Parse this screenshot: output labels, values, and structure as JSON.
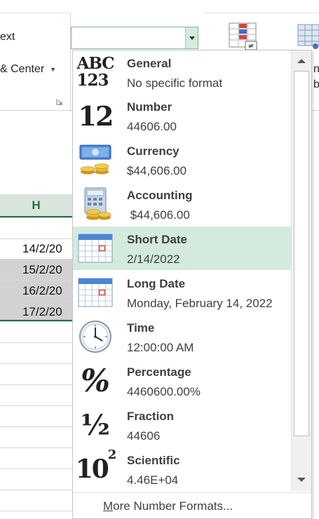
{
  "ribbon": {
    "wrap_text_fragment": "ext",
    "merge_center_fragment": "& Center",
    "number_format_value": "",
    "right_fragment_1": "na",
    "right_fragment_2": "ble"
  },
  "sheet": {
    "column_header": "H",
    "cells": [
      "14/2/20",
      "15/2/20",
      "16/2/20",
      "17/2/20"
    ]
  },
  "dropdown": {
    "items": [
      {
        "name": "General",
        "sample": "No specific format",
        "icon": "general-icon"
      },
      {
        "name": "Number",
        "sample": "44606.00",
        "icon": "number-icon"
      },
      {
        "name": "Currency",
        "sample": "$44,606.00",
        "icon": "currency-icon"
      },
      {
        "name": "Accounting",
        "sample": " $44,606.00",
        "icon": "accounting-icon"
      },
      {
        "name": "Short Date",
        "sample": "2/14/2022",
        "icon": "short-date-icon"
      },
      {
        "name": "Long Date",
        "sample": "Monday, February 14, 2022",
        "icon": "long-date-icon"
      },
      {
        "name": "Time",
        "sample": "12:00:00 AM",
        "icon": "clock-icon"
      },
      {
        "name": "Percentage",
        "sample": "4460600.00%",
        "icon": "percent-icon"
      },
      {
        "name": "Fraction",
        "sample": "44606",
        "icon": "fraction-icon"
      },
      {
        "name": "Scientific",
        "sample": "4.46E+04",
        "icon": "scientific-icon"
      }
    ],
    "more_formats_accel": "M",
    "more_formats_rest": "ore Number Formats..."
  },
  "glyphs": {
    "abc": "ABC",
    "n123": "123",
    "twelve": "12",
    "percent": "%",
    "half": "½",
    "ten": "10",
    "exp": "2"
  },
  "colors": {
    "accent_green": "#217346",
    "hover_green": "#d3ebdd",
    "selected_cell": "#d2d2d2"
  }
}
